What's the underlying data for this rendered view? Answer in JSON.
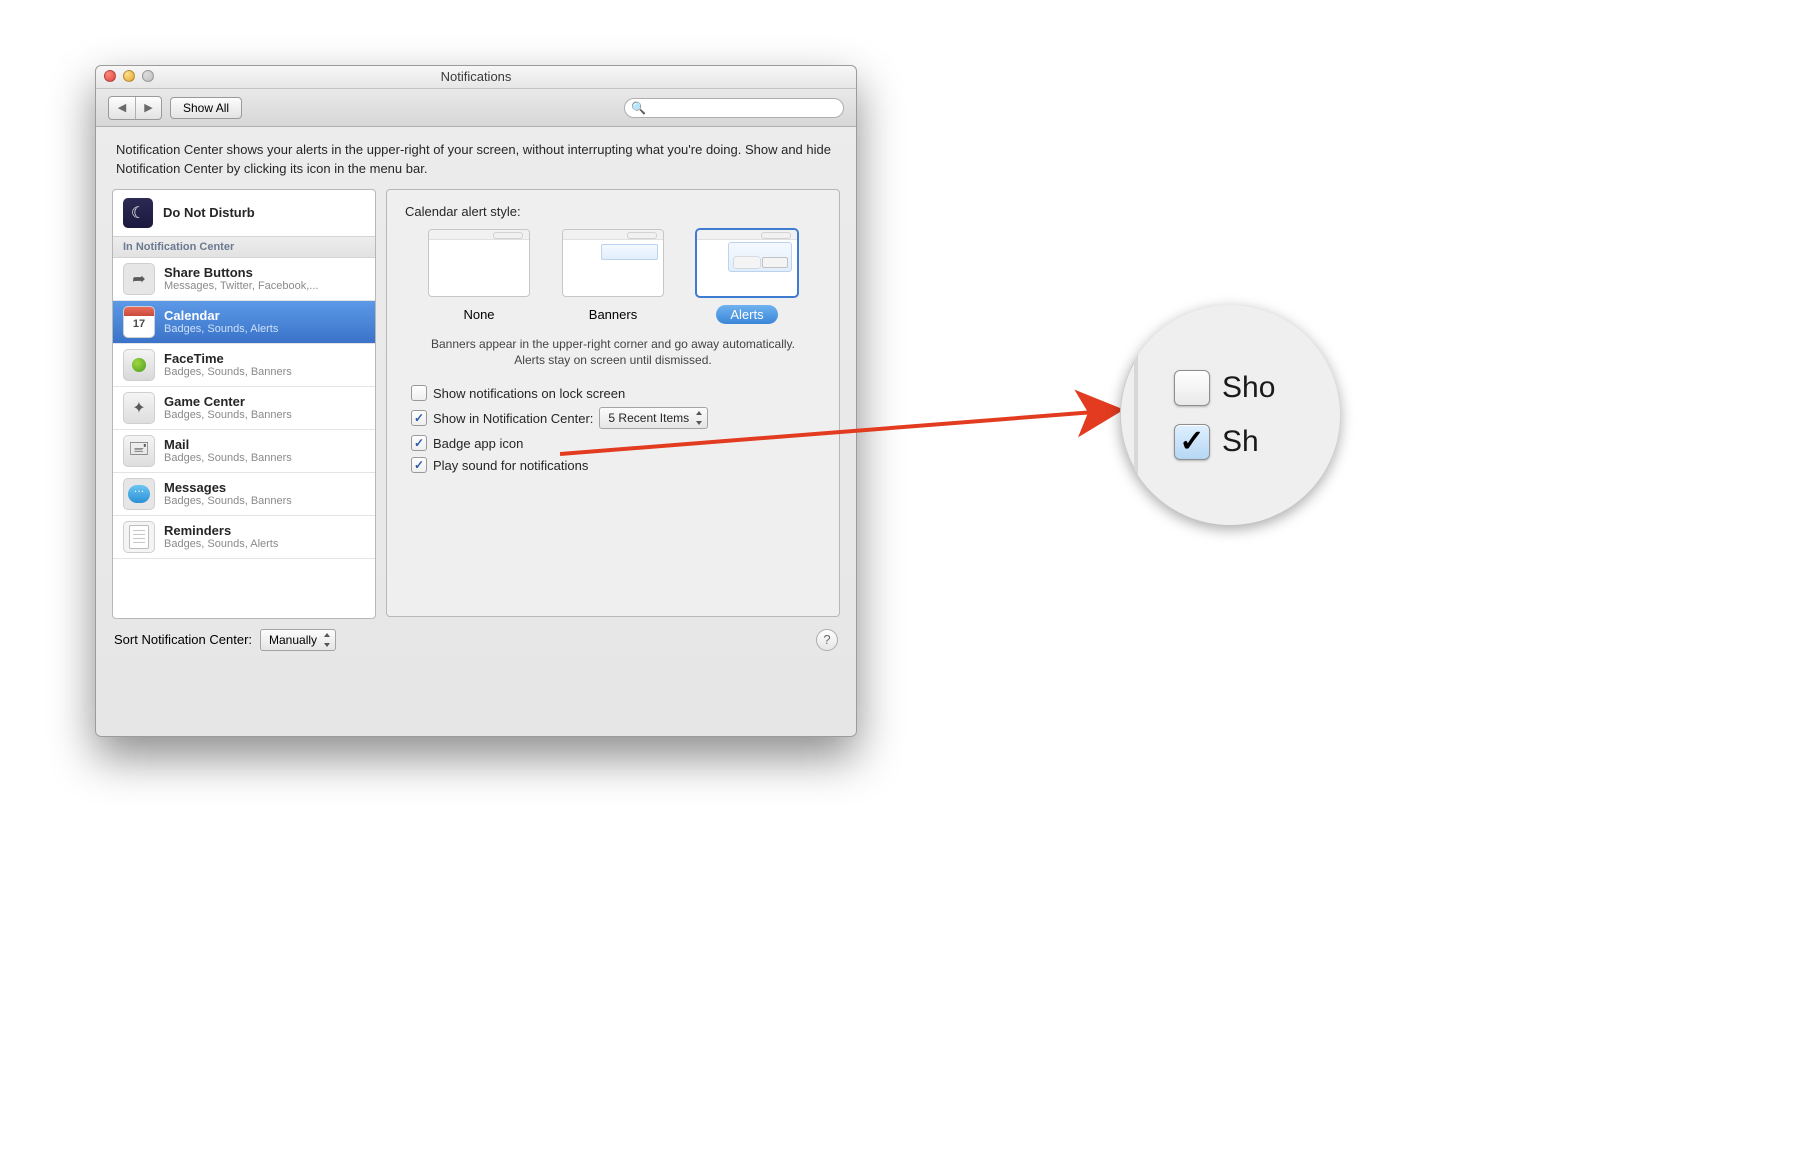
{
  "window": {
    "title": "Notifications"
  },
  "toolbar": {
    "back_glyph": "◀",
    "fwd_glyph": "▶",
    "showall_label": "Show All",
    "search_placeholder": ""
  },
  "description": "Notification Center shows your alerts in the upper-right of your screen, without interrupting what you're doing. Show and hide Notification Center by clicking its icon in the menu bar.",
  "sidebar": {
    "dnd_label": "Do Not Disturb",
    "section_header": "In Notification Center",
    "apps": [
      {
        "title": "Share Buttons",
        "sub": "Messages, Twitter, Facebook,...",
        "icon": "share",
        "selected": false
      },
      {
        "title": "Calendar",
        "sub": "Badges, Sounds, Alerts",
        "icon": "cal",
        "cal_day": "17",
        "selected": true
      },
      {
        "title": "FaceTime",
        "sub": "Badges, Sounds, Banners",
        "icon": "ft",
        "selected": false
      },
      {
        "title": "Game Center",
        "sub": "Badges, Sounds, Banners",
        "icon": "gc",
        "selected": false
      },
      {
        "title": "Mail",
        "sub": "Badges, Sounds, Banners",
        "icon": "mail",
        "selected": false
      },
      {
        "title": "Messages",
        "sub": "Badges, Sounds, Banners",
        "icon": "msg",
        "selected": false
      },
      {
        "title": "Reminders",
        "sub": "Badges, Sounds, Alerts",
        "icon": "rem",
        "selected": false
      }
    ]
  },
  "detail": {
    "heading": "Calendar alert style:",
    "styles": [
      {
        "key": "none",
        "label": "None",
        "selected": false
      },
      {
        "key": "banners",
        "label": "Banners",
        "selected": false
      },
      {
        "key": "alerts",
        "label": "Alerts",
        "selected": true
      }
    ],
    "style_desc": "Banners appear in the upper-right corner and go away automatically. Alerts stay on screen until dismissed.",
    "options": {
      "lockscreen": {
        "label": "Show notifications on lock screen",
        "checked": false
      },
      "in_nc": {
        "label": "Show in Notification Center:",
        "checked": true,
        "value": "5 Recent Items"
      },
      "badge": {
        "label": "Badge app icon",
        "checked": true
      },
      "sound": {
        "label": "Play sound for notifications",
        "checked": true
      }
    }
  },
  "footer": {
    "sort_label": "Sort Notification Center:",
    "sort_value": "Manually",
    "help_glyph": "?"
  },
  "magnifier": {
    "row1": {
      "text": "Sho",
      "checked": false
    },
    "row2": {
      "text": "Sh",
      "checked": true
    }
  }
}
